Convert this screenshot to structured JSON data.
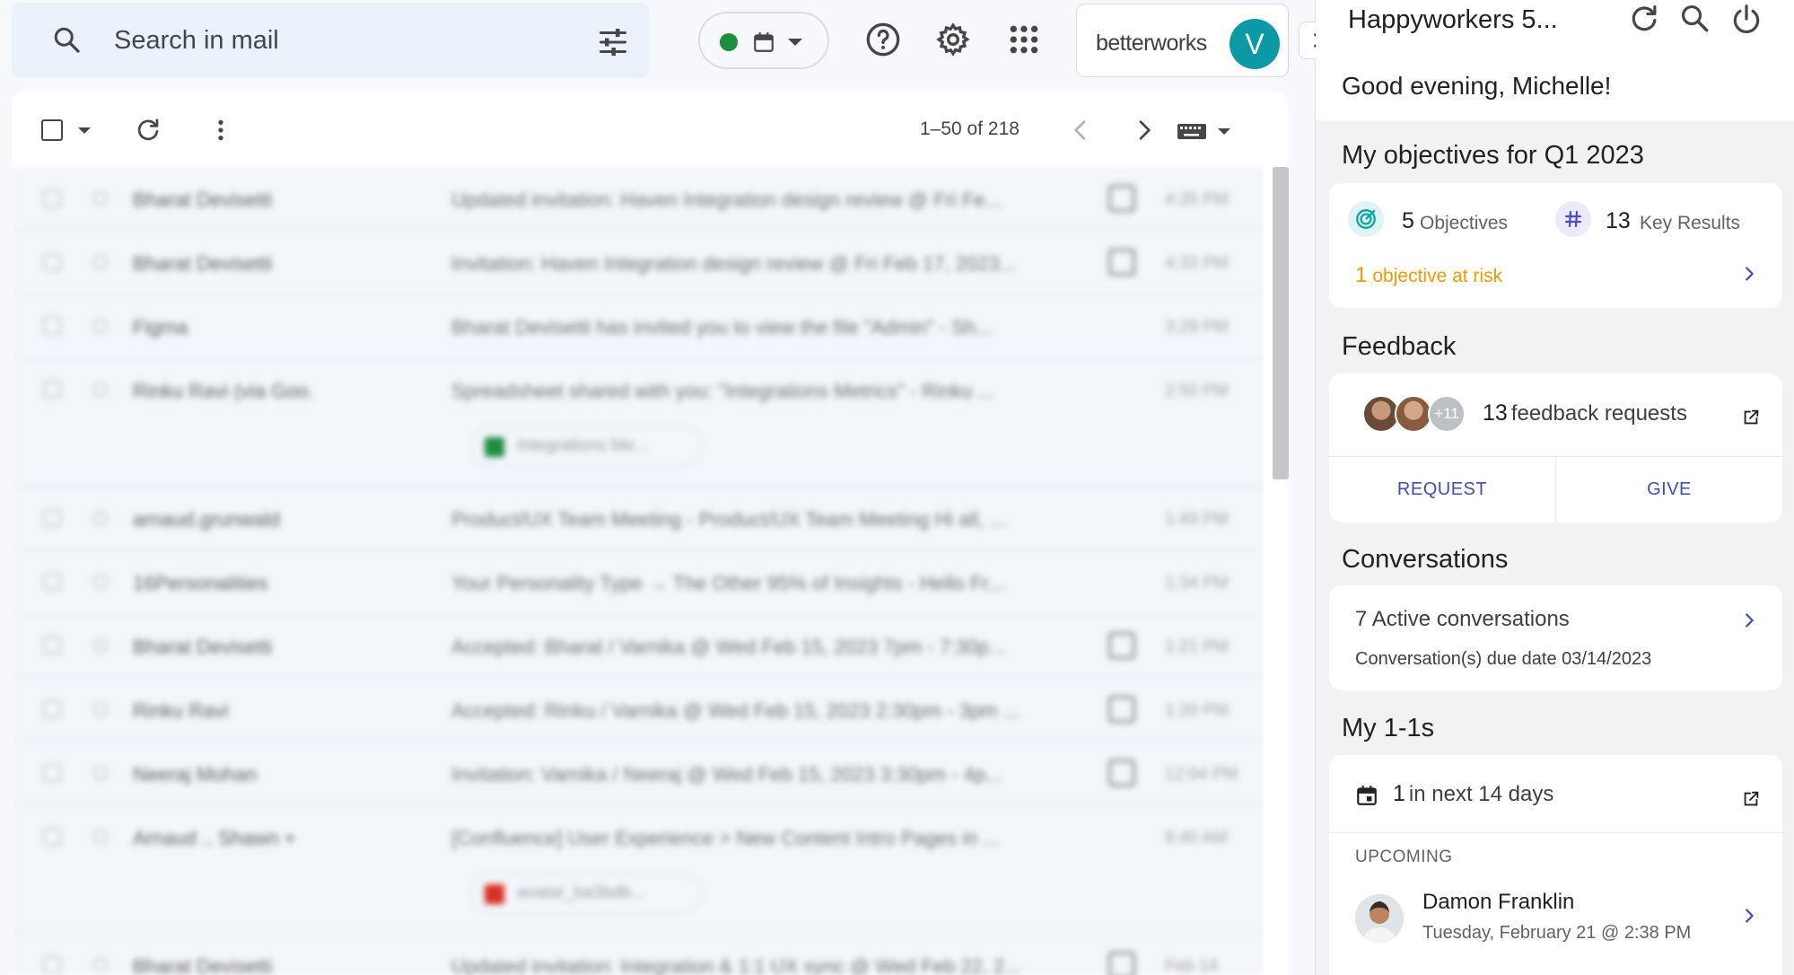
{
  "search": {
    "placeholder": "Search in mail",
    "icon": "search-icon",
    "filter_icon": "tune-icon"
  },
  "status": {
    "dot_color": "#1e8e3e",
    "icon": "calendar-icon"
  },
  "top_icons": [
    "help-icon",
    "settings-icon",
    "apps-icon"
  ],
  "account": {
    "brand": "betterworks",
    "avatar_letter": "V",
    "avatar_color": "#0b9aa5"
  },
  "toolbar": {
    "range": "1–50 of 218"
  },
  "mail": {
    "rows": [
      {
        "sender": "Bharat Devisetti",
        "subject": "Updated invitation: Haven Integration design review @ Fri Fe...",
        "time": "4:35 PM",
        "has_cal": true
      },
      {
        "sender": "Bharat Devisetti",
        "subject": "Invitation: Haven Integration design review @ Fri Feb 17, 2023...",
        "time": "4:33 PM",
        "has_cal": true
      },
      {
        "sender": "Figma",
        "subject": "Bharat Devisetti has invited you to view the file \"Admin\" - Sh...",
        "time": "3:29 PM",
        "has_cal": false
      },
      {
        "sender": "Rinku Ravi (via Goo.",
        "subject": "Spreadsheet shared with you: \"Integrations Metrics\" - Rinku ...",
        "time": "2:50 PM",
        "has_cal": false,
        "attachment": "Integrations Me..."
      },
      {
        "sender": "arnaud.grunwald",
        "subject": "Product/UX Team Meeting - Product/UX Team Meeting Hi all, ...",
        "time": "1:49 PM",
        "has_cal": false
      },
      {
        "sender": "16Personalities",
        "subject": "Your Personality Type → The Other 95% of Insights - Hello Fr...",
        "time": "1:34 PM",
        "has_cal": false
      },
      {
        "sender": "Bharat Devisetti",
        "subject": "Accepted: Bharat / Varnika @ Wed Feb 15, 2023 7pm - 7:30p...",
        "time": "1:21 PM",
        "has_cal": true
      },
      {
        "sender": "Rinku Ravi",
        "subject": "Accepted: Rinku / Varnika @ Wed Feb 15, 2023 2:30pm - 3pm ...",
        "time": "1:20 PM",
        "has_cal": true
      },
      {
        "sender": "Neeraj Mohan",
        "subject": "Invitation: Varnika / Neeraj @ Wed Feb 15, 2023 3:30pm - 4p...",
        "time": "12:04 PM",
        "has_cal": true
      },
      {
        "sender": "Arnaud .. Shawn +",
        "subject": "[Confluence] User Experience > New Content Intro Pages in ...",
        "time": "8:40 AM",
        "has_cal": false,
        "attachment": "avatar_ba3bdb..."
      },
      {
        "sender": "Bharat Devisetti",
        "subject": "Updated invitation: Integration & 1:1 UX sync @ Wed Feb 22, 2...",
        "time": "Feb 14",
        "has_cal": true
      }
    ]
  },
  "side": {
    "title": "Happyworkers 5...",
    "greeting": "Good evening, Michelle!",
    "objectives": {
      "title": "My objectives for Q1 2023",
      "objectives_count": "5",
      "objectives_label": "Objectives",
      "kr_count": "13",
      "kr_label": "Key Results",
      "risk_count": "1",
      "risk_label": "objective at risk"
    },
    "feedback": {
      "title": "Feedback",
      "more": "+11",
      "count": "13",
      "label": "feedback requests",
      "request": "REQUEST",
      "give": "GIVE"
    },
    "conversations": {
      "title": "Conversations",
      "active": "7 Active conversations",
      "due": "Conversation(s) due date 03/14/2023"
    },
    "one_on_ones": {
      "title": "My 1-1s",
      "count": "1",
      "label": "in next 14 days",
      "upcoming": "UPCOMING",
      "person": "Damon Franklin",
      "when": "Tuesday, February 21 @ 2:38 PM"
    }
  }
}
